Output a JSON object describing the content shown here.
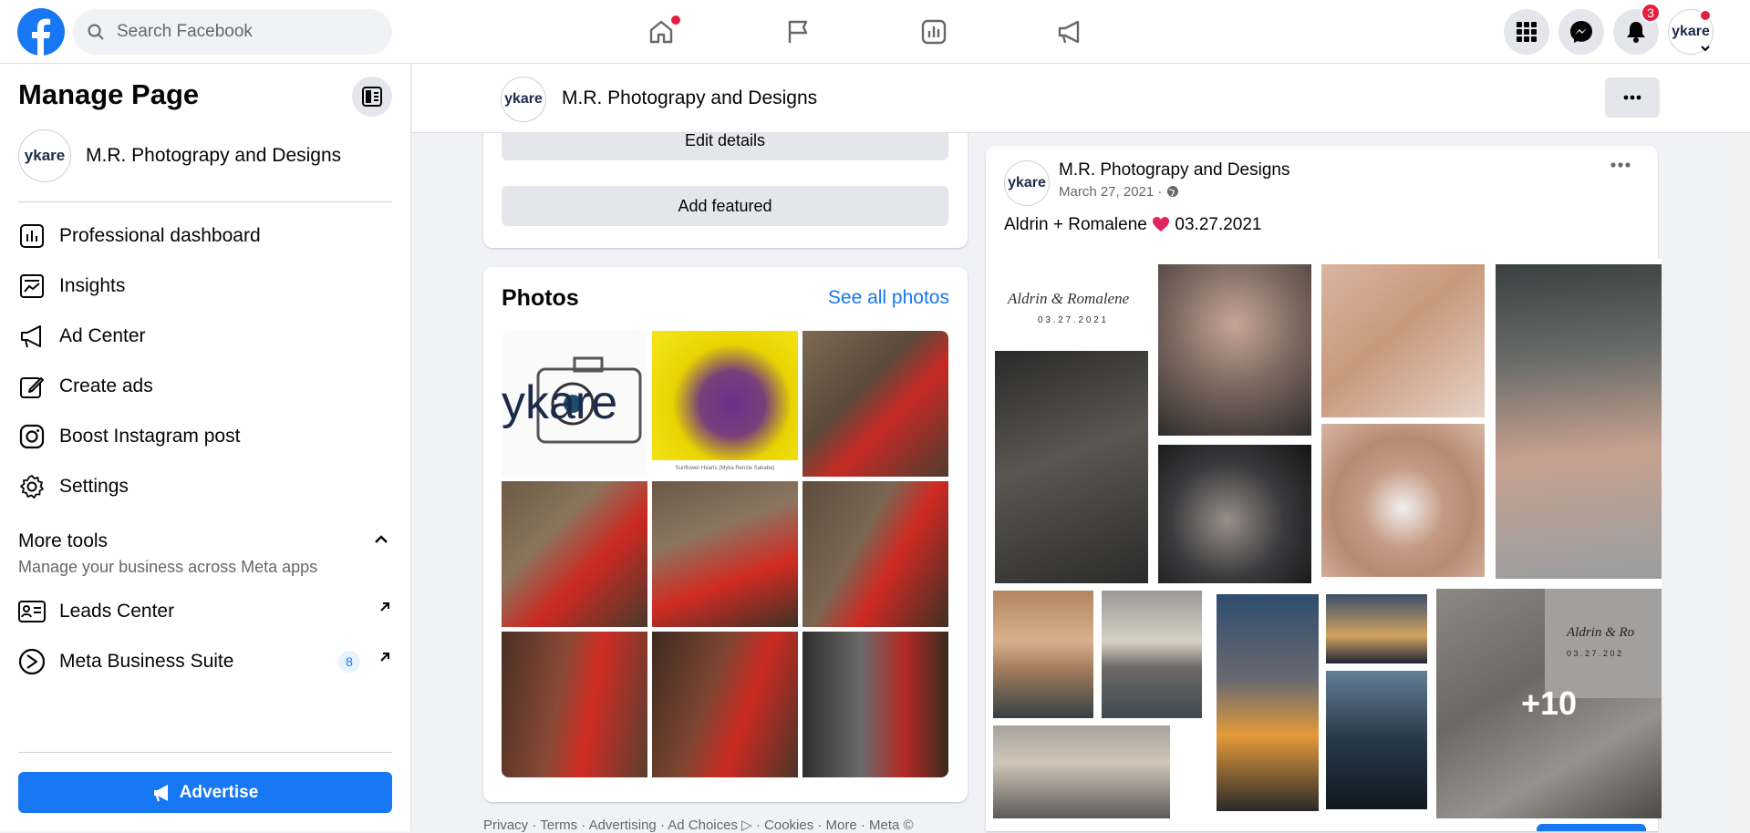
{
  "topbar": {
    "search_placeholder": "Search Facebook",
    "notification_count": "3",
    "nav_icons": [
      "home-icon",
      "flag-icon",
      "insights-icon",
      "megaphone-icon"
    ],
    "right_icons": [
      "menu-grid-icon",
      "messenger-icon",
      "bell-icon",
      "account-avatar"
    ]
  },
  "sidebar": {
    "title": "Manage Page",
    "page_name": "M.R. Photograpy and Designs",
    "items": [
      {
        "label": "Professional dashboard",
        "icon": "dashboard-icon"
      },
      {
        "label": "Insights",
        "icon": "insights-icon"
      },
      {
        "label": "Ad Center",
        "icon": "megaphone-icon"
      },
      {
        "label": "Create ads",
        "icon": "pencil-icon"
      },
      {
        "label": "Boost Instagram post",
        "icon": "instagram-icon"
      },
      {
        "label": "Settings",
        "icon": "gear-icon"
      }
    ],
    "more_tools": {
      "title": "More tools",
      "subtitle": "Manage your business across Meta apps",
      "items": [
        {
          "label": "Leads Center",
          "icon": "contact-card-icon"
        },
        {
          "label": "Meta Business Suite",
          "icon": "business-suite-icon",
          "count": "8"
        }
      ]
    },
    "advertise_label": "Advertise"
  },
  "page_header": {
    "name": "M.R. Photograpy and Designs"
  },
  "left_column": {
    "edit_details": "Edit details",
    "add_featured": "Add featured",
    "photos_title": "Photos",
    "see_all": "See all photos",
    "logo_text": "ykare",
    "sunflower_caption": "Sunflower Hearts (Myka Renzie Sababa)"
  },
  "footer": {
    "links": "Privacy · Terms · Advertising · Ad Choices ▷ · Cookies · More · Meta ©"
  },
  "post": {
    "author": "M.R. Photograpy and Designs",
    "date": "March 27, 2021 · ",
    "text_before": "Aldrin + Romalene ",
    "text_after": " 03.27.2021",
    "card_title": "Aldrin & Romalene",
    "card_date": "0 3 . 2 7 . 2 0 2 1",
    "card_title_2": "Aldrin & Ro",
    "card_date_2": "0 3 . 2 7 . 2 0 2",
    "overlay_count": "+10"
  },
  "colors": {
    "brand": "#1877f2",
    "notification": "#e41e3f",
    "background": "#f0f2f5"
  }
}
